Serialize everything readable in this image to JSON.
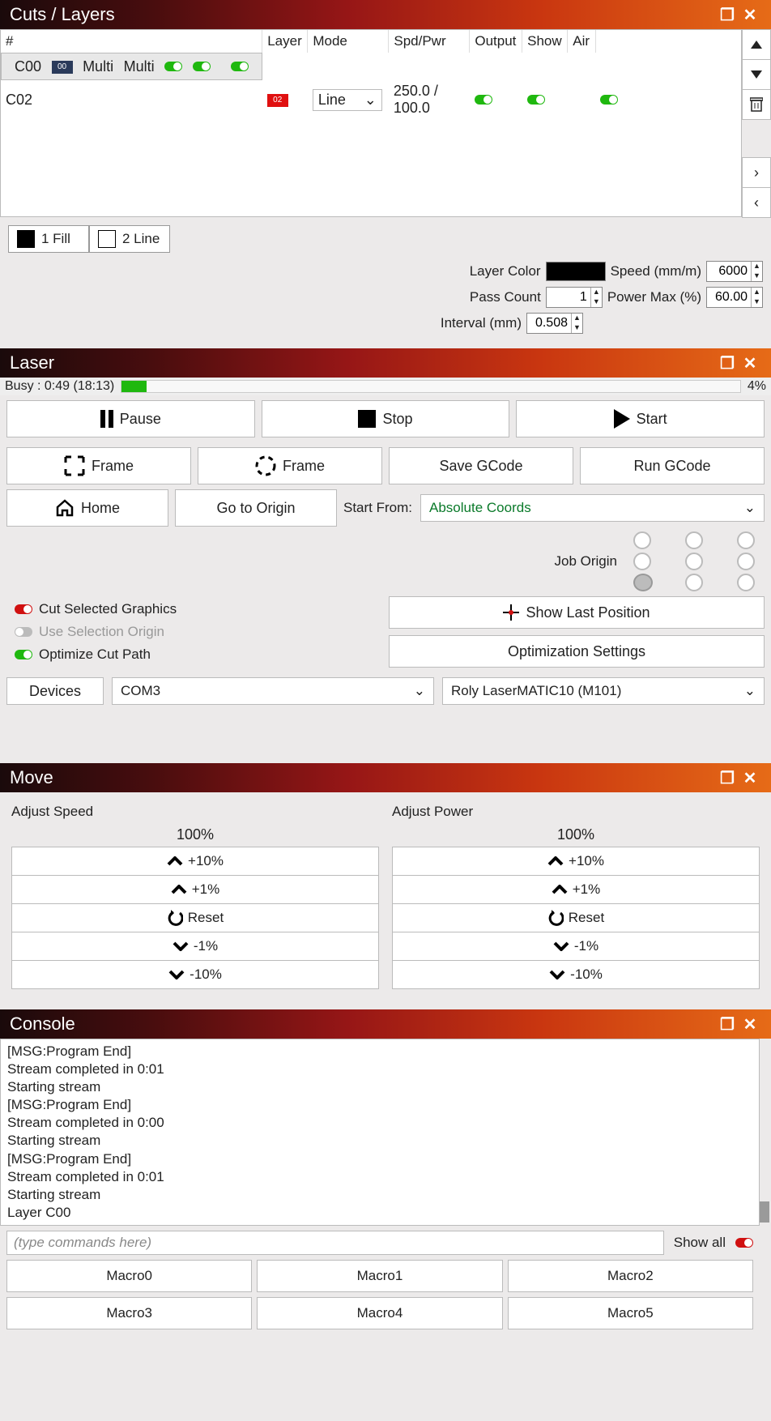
{
  "cuts": {
    "title": "Cuts / Layers",
    "headers": {
      "num": "#",
      "layer": "Layer",
      "mode": "Mode",
      "spd": "Spd/Pwr",
      "output": "Output",
      "show": "Show",
      "air": "Air"
    },
    "rows": [
      {
        "num": "C00",
        "swatch": "00",
        "mode": "Multi",
        "spd": "Multi",
        "output": true,
        "show": true,
        "air": true,
        "selected": true,
        "swclass": "sw-dark"
      },
      {
        "num": "C02",
        "swatch": "02",
        "mode": "Line",
        "spd": "250.0 / 100.0",
        "output": true,
        "show": true,
        "air": true,
        "selected": false,
        "swclass": "sw-red"
      }
    ],
    "tabs": {
      "t1": "1 Fill",
      "t2": "2 Line"
    },
    "params": {
      "layer_color": "Layer Color",
      "speed_lbl": "Speed (mm/m)",
      "speed_val": "6000",
      "pass_lbl": "Pass Count",
      "pass_val": "1",
      "power_lbl": "Power Max (%)",
      "power_val": "60.00",
      "interval_lbl": "Interval (mm)",
      "interval_val": "0.508"
    }
  },
  "laser": {
    "title": "Laser",
    "status": "Busy : 0:49 (18:13)",
    "percent": "4%",
    "progress_pct": 4,
    "pause": "Pause",
    "stop": "Stop",
    "start": "Start",
    "frame1": "Frame",
    "frame2": "Frame",
    "save_gcode": "Save GCode",
    "run_gcode": "Run GCode",
    "home": "Home",
    "goto_origin": "Go to Origin",
    "start_from_lbl": "Start From:",
    "start_from_val": "Absolute Coords",
    "job_origin_lbl": "Job Origin",
    "cut_sel": "Cut Selected Graphics",
    "use_sel": "Use Selection Origin",
    "opt_cut": "Optimize Cut Path",
    "show_last": "Show Last Position",
    "opt_settings": "Optimization Settings",
    "devices": "Devices",
    "port": "COM3",
    "machine": "Roly LaserMATIC10 (M101)"
  },
  "move": {
    "title": "Move",
    "speed": {
      "label": "Adjust Speed",
      "pct": "100%",
      "p10": "+10%",
      "p1": "+1%",
      "reset": "Reset",
      "m1": "-1%",
      "m10": "-10%"
    },
    "power": {
      "label": "Adjust Power",
      "pct": "100%",
      "p10": "+10%",
      "p1": "+1%",
      "reset": "Reset",
      "m1": "-1%",
      "m10": "-10%"
    }
  },
  "console": {
    "title": "Console",
    "lines": [
      "[MSG:Program End]",
      "Stream completed in 0:01",
      "Starting stream",
      "[MSG:Program End]",
      "Stream completed in 0:00",
      "Starting stream",
      "[MSG:Program End]",
      "Stream completed in 0:01",
      "Starting stream",
      "Layer C00"
    ],
    "placeholder": "(type commands here)",
    "show_all": "Show all",
    "macros": [
      "Macro0",
      "Macro1",
      "Macro2",
      "Macro3",
      "Macro4",
      "Macro5"
    ]
  }
}
